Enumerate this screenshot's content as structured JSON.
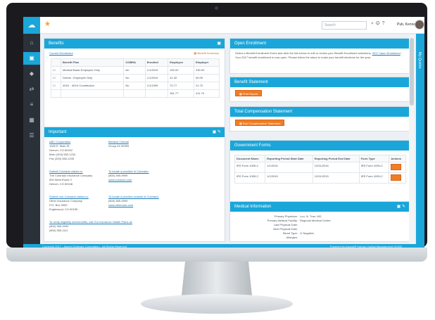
{
  "app": {
    "search_placeholder": "Search",
    "user_name": "Pub, Kenneth"
  },
  "right_rail": {
    "label": "My Quicks"
  },
  "footer": {
    "left": "Copyright 2017 - Ascent Software Corporation - All Rights Reserved",
    "right": "Powered by Ascent® Human Capital Management (HCM)"
  },
  "benefits": {
    "title": "Benefits",
    "current_enrollment": "Current Enrollment",
    "summary_link": "Benefit Summary",
    "columns": [
      "",
      "Benefit Plan",
      "COBRA",
      "Enrolled",
      "Employee",
      "Employer"
    ],
    "rows": [
      [
        "☐",
        "Medical Basic Employee Only",
        "No",
        "1/1/2019",
        "150.00",
        "330.00"
      ],
      [
        "☐",
        "Dental - Employee Only",
        "No",
        "1/1/2019",
        "41.00",
        "60.00"
      ],
      [
        "☐",
        "401K - 401K Contribution",
        "No",
        "1/1/1999",
        "70.77",
        "21.70"
      ]
    ],
    "totals": [
      "",
      "",
      "",
      "",
      "261.77",
      "411.70"
    ],
    "summary_note": "Pending Benefit Selections"
  },
  "important_contacts": {
    "title": "Important",
    "blocks": [
      [
        "ABC Corporation",
        "1000 E. Main St",
        "Denver, CO 80202",
        "Main (303) 555-1234",
        "Fax (303) 555-1235"
      ],
      [
        "Medical / Dental",
        "Group #1-99999"
      ],
      [
        "Submit Colorado claims to:",
        "The Colorado Insurance Company",
        "500 West Route 2",
        "Denver, CO 80248"
      ],
      [
        "To locate a provider in Colorado:",
        "(800) 555-9999",
        "www.coinsure.com"
      ],
      [
        "Submit non-Colorado claims to:",
        "Other Insurance Company",
        "P.O. Box 9999",
        "Englewood, CO 80155"
      ],
      [
        "To locate a provider outside of Colorado:",
        "(800) 555-9999",
        "www.othercare.com"
      ],
      [
        "To verify eligibility and benefits, call Our Insurance Health Plans at:",
        "(800) 555-9999",
        "(800) 555-1111"
      ]
    ]
  },
  "open_enrollment": {
    "title": "Open Enrollment",
    "text": "Select a Benefit Enrollment Event and click the link below to edit or review your Benefit Enrollment selections.",
    "link": "2017 Open Enrollment",
    "text2": "Your 2017 benefit enrollment is now open. Please follow the steps to make your benefit elections for the year."
  },
  "benefit_statement": {
    "title": "Benefit Statement",
    "button": "Print Report"
  },
  "total_comp": {
    "title": "Total Compensation Statement",
    "button": "Run Compensation Statement"
  },
  "govt_forms": {
    "title": "Government Forms",
    "columns": [
      "Document Name",
      "Reporting Period Start Date",
      "Reporting Period End Date",
      "Form Type",
      "Actions"
    ],
    "rows": [
      [
        "IRS Form 1095-C",
        "1/1/2016",
        "12/31/2016",
        "IRS Form 1095-C",
        ""
      ],
      [
        "IRS Form 1095-C",
        "1/1/2015",
        "12/31/2015",
        "IRS Form 1095-C",
        ""
      ]
    ]
  },
  "medical_info": {
    "title": "Medical Information",
    "rows": [
      [
        "Primary Physician:",
        "Luu, N. Tran, MD"
      ],
      [
        "Primary Medical Facility:",
        "Regional Medical Center"
      ],
      [
        "Last Physical Date:",
        ""
      ],
      [
        "Next Physical Date:",
        ""
      ],
      [
        "Blood Type:",
        "O Negative"
      ],
      [
        "Allergies:",
        ""
      ]
    ]
  }
}
